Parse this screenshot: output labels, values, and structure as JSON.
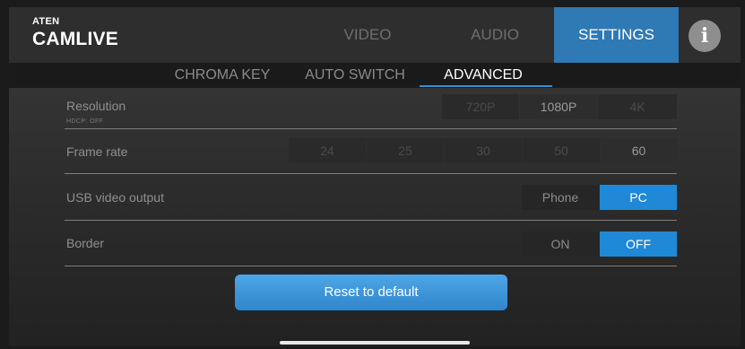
{
  "brand": {
    "top": "ATEN",
    "name": "CAMLIVE"
  },
  "nav": {
    "video": "VIDEO",
    "audio": "AUDIO",
    "settings": "SETTINGS",
    "info_icon": "i"
  },
  "subtabs": {
    "chroma": "CHROMA KEY",
    "auto": "AUTO SWITCH",
    "advanced": "ADVANCED"
  },
  "resolution": {
    "label": "Resolution",
    "note": "HDCP: OFF",
    "options": [
      "720P",
      "1080P",
      "4K"
    ],
    "selected": "1080P"
  },
  "framerate": {
    "label": "Frame rate",
    "options": [
      "24",
      "25",
      "30",
      "50",
      "60"
    ],
    "selected": "60"
  },
  "usb": {
    "label": "USB video output",
    "options": [
      "Phone",
      "PC"
    ],
    "selected": "PC"
  },
  "border": {
    "label": "Border",
    "options": [
      "ON",
      "OFF"
    ],
    "selected": "OFF"
  },
  "reset_label": "Reset to default",
  "colors": {
    "accent": "#1f89d8",
    "settings_tab": "#2f79b4",
    "button": "#3a94d8"
  }
}
